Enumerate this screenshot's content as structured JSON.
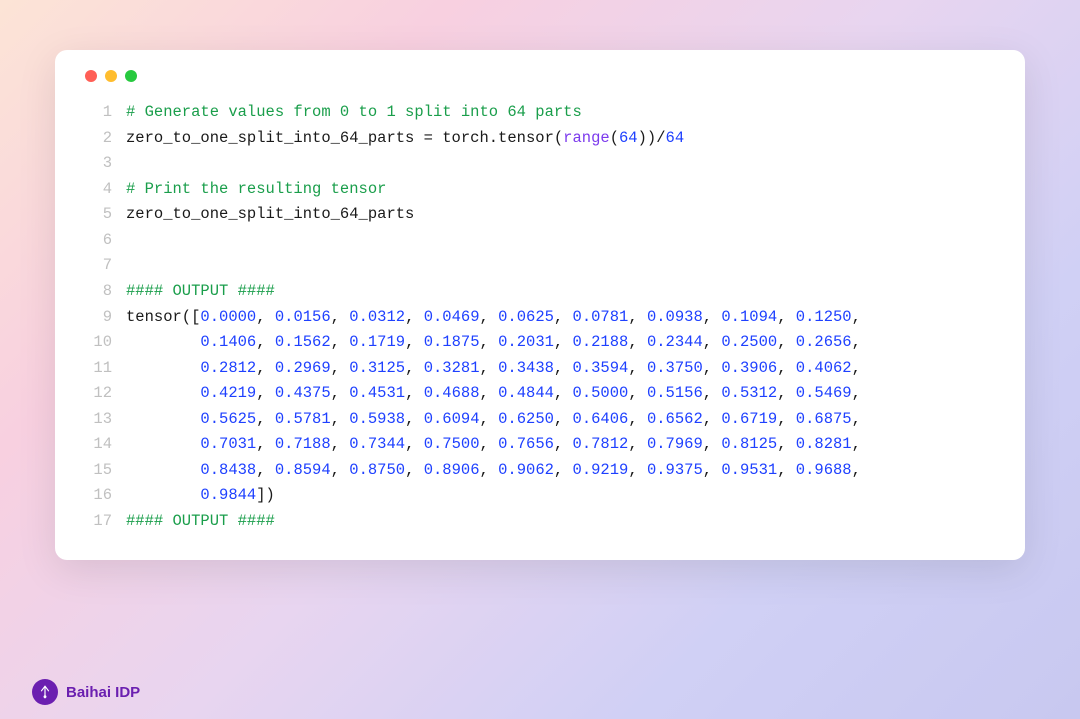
{
  "brand": "Baihai IDP",
  "traffic": [
    "red",
    "yellow",
    "green"
  ],
  "code": {
    "lines": [
      {
        "n": 1,
        "seg": [
          [
            "comment",
            "# Generate values from 0 to 1 split into 64 parts"
          ]
        ]
      },
      {
        "n": 2,
        "seg": [
          [
            "plain",
            "zero_to_one_split_into_64_parts = torch.tensor("
          ],
          [
            "func",
            "range"
          ],
          [
            "plain",
            "("
          ],
          [
            "num",
            "64"
          ],
          [
            "plain",
            "))/"
          ],
          [
            "num",
            "64"
          ]
        ]
      },
      {
        "n": 3,
        "seg": [
          [
            "plain",
            ""
          ]
        ]
      },
      {
        "n": 4,
        "seg": [
          [
            "comment",
            "# Print the resulting tensor"
          ]
        ]
      },
      {
        "n": 5,
        "seg": [
          [
            "plain",
            "zero_to_one_split_into_64_parts"
          ]
        ]
      },
      {
        "n": 6,
        "seg": [
          [
            "plain",
            ""
          ]
        ]
      },
      {
        "n": 7,
        "seg": [
          [
            "plain",
            ""
          ]
        ]
      },
      {
        "n": 8,
        "seg": [
          [
            "comment",
            "#### OUTPUT ####"
          ]
        ]
      },
      {
        "n": 9,
        "seg": [
          [
            "plain",
            "tensor(["
          ],
          [
            "num",
            "0.0000"
          ],
          [
            "plain",
            ", "
          ],
          [
            "num",
            "0.0156"
          ],
          [
            "plain",
            ", "
          ],
          [
            "num",
            "0.0312"
          ],
          [
            "plain",
            ", "
          ],
          [
            "num",
            "0.0469"
          ],
          [
            "plain",
            ", "
          ],
          [
            "num",
            "0.0625"
          ],
          [
            "plain",
            ", "
          ],
          [
            "num",
            "0.0781"
          ],
          [
            "plain",
            ", "
          ],
          [
            "num",
            "0.0938"
          ],
          [
            "plain",
            ", "
          ],
          [
            "num",
            "0.1094"
          ],
          [
            "plain",
            ", "
          ],
          [
            "num",
            "0.1250"
          ],
          [
            "plain",
            ","
          ]
        ]
      },
      {
        "n": 10,
        "seg": [
          [
            "plain",
            "        "
          ],
          [
            "num",
            "0.1406"
          ],
          [
            "plain",
            ", "
          ],
          [
            "num",
            "0.1562"
          ],
          [
            "plain",
            ", "
          ],
          [
            "num",
            "0.1719"
          ],
          [
            "plain",
            ", "
          ],
          [
            "num",
            "0.1875"
          ],
          [
            "plain",
            ", "
          ],
          [
            "num",
            "0.2031"
          ],
          [
            "plain",
            ", "
          ],
          [
            "num",
            "0.2188"
          ],
          [
            "plain",
            ", "
          ],
          [
            "num",
            "0.2344"
          ],
          [
            "plain",
            ", "
          ],
          [
            "num",
            "0.2500"
          ],
          [
            "plain",
            ", "
          ],
          [
            "num",
            "0.2656"
          ],
          [
            "plain",
            ","
          ]
        ]
      },
      {
        "n": 11,
        "seg": [
          [
            "plain",
            "        "
          ],
          [
            "num",
            "0.2812"
          ],
          [
            "plain",
            ", "
          ],
          [
            "num",
            "0.2969"
          ],
          [
            "plain",
            ", "
          ],
          [
            "num",
            "0.3125"
          ],
          [
            "plain",
            ", "
          ],
          [
            "num",
            "0.3281"
          ],
          [
            "plain",
            ", "
          ],
          [
            "num",
            "0.3438"
          ],
          [
            "plain",
            ", "
          ],
          [
            "num",
            "0.3594"
          ],
          [
            "plain",
            ", "
          ],
          [
            "num",
            "0.3750"
          ],
          [
            "plain",
            ", "
          ],
          [
            "num",
            "0.3906"
          ],
          [
            "plain",
            ", "
          ],
          [
            "num",
            "0.4062"
          ],
          [
            "plain",
            ","
          ]
        ]
      },
      {
        "n": 12,
        "seg": [
          [
            "plain",
            "        "
          ],
          [
            "num",
            "0.4219"
          ],
          [
            "plain",
            ", "
          ],
          [
            "num",
            "0.4375"
          ],
          [
            "plain",
            ", "
          ],
          [
            "num",
            "0.4531"
          ],
          [
            "plain",
            ", "
          ],
          [
            "num",
            "0.4688"
          ],
          [
            "plain",
            ", "
          ],
          [
            "num",
            "0.4844"
          ],
          [
            "plain",
            ", "
          ],
          [
            "num",
            "0.5000"
          ],
          [
            "plain",
            ", "
          ],
          [
            "num",
            "0.5156"
          ],
          [
            "plain",
            ", "
          ],
          [
            "num",
            "0.5312"
          ],
          [
            "plain",
            ", "
          ],
          [
            "num",
            "0.5469"
          ],
          [
            "plain",
            ","
          ]
        ]
      },
      {
        "n": 13,
        "seg": [
          [
            "plain",
            "        "
          ],
          [
            "num",
            "0.5625"
          ],
          [
            "plain",
            ", "
          ],
          [
            "num",
            "0.5781"
          ],
          [
            "plain",
            ", "
          ],
          [
            "num",
            "0.5938"
          ],
          [
            "plain",
            ", "
          ],
          [
            "num",
            "0.6094"
          ],
          [
            "plain",
            ", "
          ],
          [
            "num",
            "0.6250"
          ],
          [
            "plain",
            ", "
          ],
          [
            "num",
            "0.6406"
          ],
          [
            "plain",
            ", "
          ],
          [
            "num",
            "0.6562"
          ],
          [
            "plain",
            ", "
          ],
          [
            "num",
            "0.6719"
          ],
          [
            "plain",
            ", "
          ],
          [
            "num",
            "0.6875"
          ],
          [
            "plain",
            ","
          ]
        ]
      },
      {
        "n": 14,
        "seg": [
          [
            "plain",
            "        "
          ],
          [
            "num",
            "0.7031"
          ],
          [
            "plain",
            ", "
          ],
          [
            "num",
            "0.7188"
          ],
          [
            "plain",
            ", "
          ],
          [
            "num",
            "0.7344"
          ],
          [
            "plain",
            ", "
          ],
          [
            "num",
            "0.7500"
          ],
          [
            "plain",
            ", "
          ],
          [
            "num",
            "0.7656"
          ],
          [
            "plain",
            ", "
          ],
          [
            "num",
            "0.7812"
          ],
          [
            "plain",
            ", "
          ],
          [
            "num",
            "0.7969"
          ],
          [
            "plain",
            ", "
          ],
          [
            "num",
            "0.8125"
          ],
          [
            "plain",
            ", "
          ],
          [
            "num",
            "0.8281"
          ],
          [
            "plain",
            ","
          ]
        ]
      },
      {
        "n": 15,
        "seg": [
          [
            "plain",
            "        "
          ],
          [
            "num",
            "0.8438"
          ],
          [
            "plain",
            ", "
          ],
          [
            "num",
            "0.8594"
          ],
          [
            "plain",
            ", "
          ],
          [
            "num",
            "0.8750"
          ],
          [
            "plain",
            ", "
          ],
          [
            "num",
            "0.8906"
          ],
          [
            "plain",
            ", "
          ],
          [
            "num",
            "0.9062"
          ],
          [
            "plain",
            ", "
          ],
          [
            "num",
            "0.9219"
          ],
          [
            "plain",
            ", "
          ],
          [
            "num",
            "0.9375"
          ],
          [
            "plain",
            ", "
          ],
          [
            "num",
            "0.9531"
          ],
          [
            "plain",
            ", "
          ],
          [
            "num",
            "0.9688"
          ],
          [
            "plain",
            ","
          ]
        ]
      },
      {
        "n": 16,
        "seg": [
          [
            "plain",
            "        "
          ],
          [
            "num",
            "0.9844"
          ],
          [
            "plain",
            "])"
          ]
        ]
      },
      {
        "n": 17,
        "seg": [
          [
            "comment",
            "#### OUTPUT ####"
          ]
        ]
      }
    ]
  }
}
